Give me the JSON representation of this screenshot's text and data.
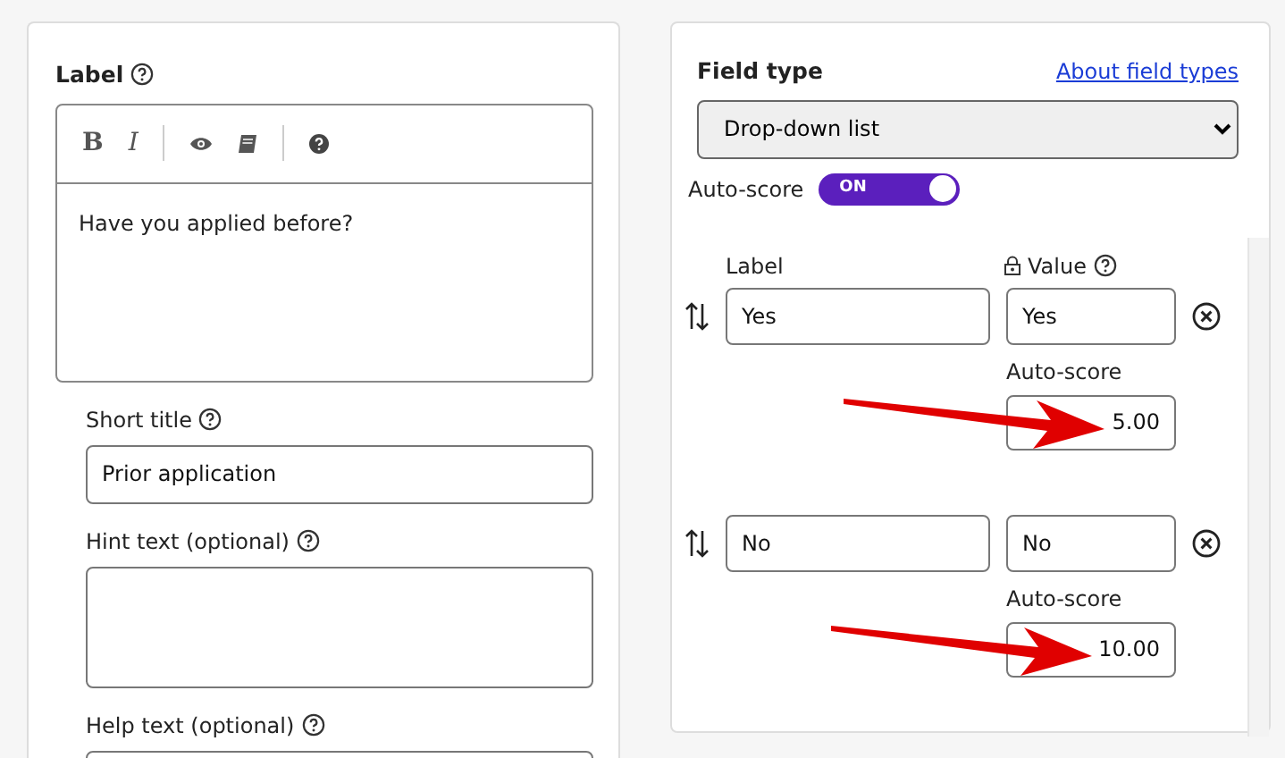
{
  "label_section": {
    "title": "Label",
    "toolbar": [
      {
        "kind": "bold",
        "text": "B"
      },
      {
        "kind": "italic",
        "text": "I"
      },
      {
        "kind": "divider"
      },
      {
        "kind": "preview"
      },
      {
        "kind": "book"
      },
      {
        "kind": "divider"
      },
      {
        "kind": "help"
      }
    ],
    "content": "Have you applied before?"
  },
  "fields": [
    {
      "label": "Short title",
      "kind": "input",
      "value": "Prior application"
    },
    {
      "label": "Hint text (optional)",
      "kind": "textarea"
    },
    {
      "label": "Help text (optional)",
      "kind": "input"
    }
  ],
  "field_type": {
    "title": "Field type",
    "link": "About field types",
    "value": "Drop-down list"
  },
  "auto_score": {
    "label": "Auto-score",
    "on": true,
    "state_text": "ON"
  },
  "options_header": {
    "label": "Label",
    "value": "Value"
  },
  "options": [
    {
      "label": "Yes",
      "value": "Yes",
      "score_label": "Auto-score",
      "score": "5.00",
      "arrow": true
    },
    {
      "label": "No",
      "value": "No",
      "score_label": "Auto-score",
      "score": "10.00",
      "arrow": true
    }
  ]
}
